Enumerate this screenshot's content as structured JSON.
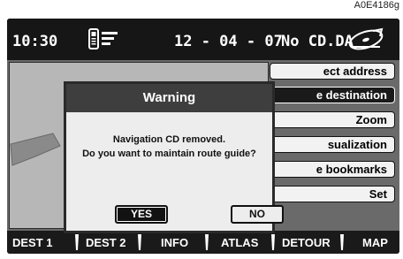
{
  "figure_code": "A0E4186g",
  "topbar": {
    "time": "10:30",
    "date": "12 - 04 - 07",
    "cd_status": "No CD.DA",
    "phone_icon": "phone-signal-icon",
    "disc_icon": "navigation-disc-icon"
  },
  "side_menu": [
    {
      "label": "ect address",
      "selected": false
    },
    {
      "label": "e destination",
      "selected": true
    },
    {
      "label": "Zoom",
      "selected": false
    },
    {
      "label": "sualization",
      "selected": false
    },
    {
      "label": "e bookmarks",
      "selected": false
    },
    {
      "label": "Set",
      "selected": false
    }
  ],
  "dialog": {
    "title": "Warning",
    "line1": "Navigation CD removed.",
    "line2": "Do you want to maintain route guide?",
    "yes_label": "YES",
    "no_label": "NO"
  },
  "bottom_tabs": [
    "DEST 1",
    "DEST 2",
    "INFO",
    "ATLAS",
    "DETOUR",
    "MAP"
  ],
  "colors": {
    "screen_bg": "#1e1e1e",
    "dialog_title_bg": "#3e3e3e",
    "selected_btn": "#1a1a1a"
  }
}
